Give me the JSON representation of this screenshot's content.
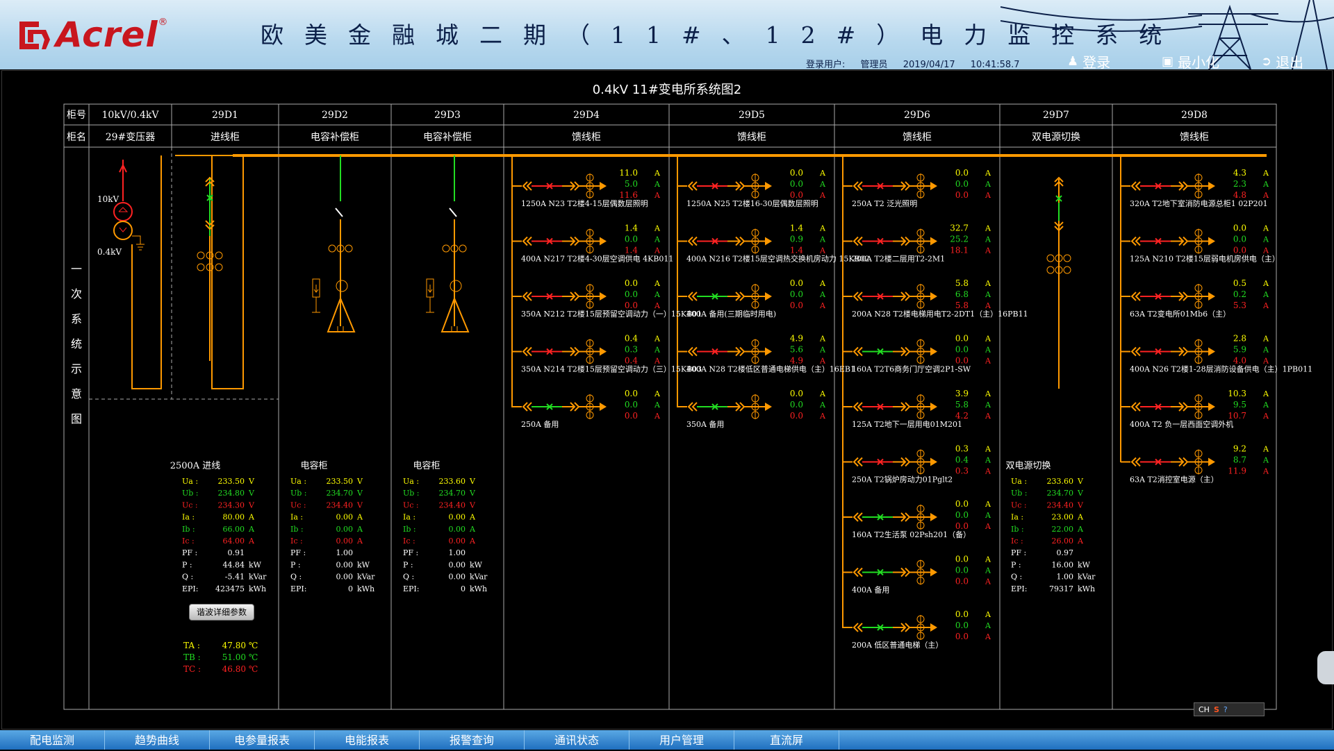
{
  "header": {
    "logo": "Acrel",
    "logo_reg": "®",
    "title": "欧美金融城二期（11#、12#）电力监控系统",
    "login_label": "登录用户:",
    "login_user": "管理员",
    "date": "2019/04/17",
    "time": "10:41:58.7",
    "btn_login": "登录",
    "btn_minimize": "最小化",
    "btn_exit": "退出"
  },
  "diagram": {
    "title": "0.4kV 11#变电所系统图2",
    "row1_label": "柜号",
    "row2_label": "柜名",
    "side_label": "一次系统示意图",
    "transformer_hv": "10kV",
    "transformer_lv": "0.4kV",
    "cabinets": [
      {
        "no": "10kV/0.4kV",
        "name": "29#变压器"
      },
      {
        "no": "29D1",
        "name": "进线柜"
      },
      {
        "no": "29D2",
        "name": "电容补偿柜"
      },
      {
        "no": "29D3",
        "name": "电容补偿柜"
      },
      {
        "no": "29D4",
        "name": "馈线柜"
      },
      {
        "no": "29D5",
        "name": "馈线柜"
      },
      {
        "no": "29D6",
        "name": "馈线柜"
      },
      {
        "no": "29D7",
        "name": "双电源切换"
      },
      {
        "no": "29D8",
        "name": "馈线柜"
      }
    ]
  },
  "feeders": {
    "d4": [
      {
        "label": "1250A N23 T2楼4-15层偶数层照明",
        "ia": "11.0",
        "ib": "5.0",
        "ic": "11.6",
        "on": false
      },
      {
        "label": "400A N217 T2楼4-30层空调供电 4KB011",
        "ia": "1.4",
        "ib": "0.0",
        "ic": "1.4",
        "on": false
      },
      {
        "label": "350A N212 T2楼15层预留空调动力（一）15KB01",
        "ia": "0.0",
        "ib": "0.0",
        "ic": "0.0",
        "on": false
      },
      {
        "label": "350A N214 T2楼15层预留空调动力（三）15KB03",
        "ia": "0.4",
        "ib": "0.3",
        "ic": "0.4",
        "on": false
      },
      {
        "label": "250A 备用",
        "ia": "0.0",
        "ib": "0.0",
        "ic": "0.0",
        "on": true
      }
    ],
    "d5": [
      {
        "label": "1250A N25 T2楼16-30层偶数层照明",
        "ia": "0.0",
        "ib": "0.0",
        "ic": "0.0",
        "on": false
      },
      {
        "label": "400A N216 T2楼15层空调热交换机房动力 15KB02",
        "ia": "1.4",
        "ib": "0.9",
        "ic": "1.4",
        "on": false
      },
      {
        "label": "400A 备用(三期临时用电)",
        "ia": "0.0",
        "ib": "0.0",
        "ic": "0.0",
        "on": true
      },
      {
        "label": "400A N28 T2楼低区普通电梯供电（主）16EB1",
        "ia": "4.9",
        "ib": "5.6",
        "ic": "4.9",
        "on": false
      },
      {
        "label": "350A 备用",
        "ia": "0.0",
        "ib": "0.0",
        "ic": "0.0",
        "on": true
      }
    ],
    "d6": [
      {
        "label": "250A T2 泛光照明",
        "ia": "0.0",
        "ib": "0.0",
        "ic": "0.0",
        "on": false
      },
      {
        "label": "200A T2楼二层用T2-2M1",
        "ia": "32.7",
        "ib": "25.2",
        "ic": "18.1",
        "on": false
      },
      {
        "label": "200A N28 T2楼电梯用电T2-2DT1（主）16PB11",
        "ia": "5.8",
        "ib": "6.8",
        "ic": "5.8",
        "on": false
      },
      {
        "label": "160A T2T6商务门厅空调2P1-SW",
        "ia": "0.0",
        "ib": "0.0",
        "ic": "0.0",
        "on": true
      },
      {
        "label": "125A T2地下一层用电01M201",
        "ia": "3.9",
        "ib": "5.8",
        "ic": "4.2",
        "on": false
      },
      {
        "label": "250A T2锅炉房动力01Pglt2",
        "ia": "0.3",
        "ib": "0.4",
        "ic": "0.3",
        "on": false
      },
      {
        "label": "160A T2生活泵 02Psh201（备）",
        "ia": "0.0",
        "ib": "0.0",
        "ic": "0.0",
        "on": true
      },
      {
        "label": "400A 备用",
        "ia": "0.0",
        "ib": "0.0",
        "ic": "0.0",
        "on": true
      },
      {
        "label": "200A 低区普通电梯（主）",
        "ia": "0.0",
        "ib": "0.0",
        "ic": "0.0",
        "on": true
      }
    ],
    "d8": [
      {
        "label": "320A T2地下室消防电源总柜1 02P201",
        "ia": "4.3",
        "ib": "2.3",
        "ic": "4.8",
        "on": false
      },
      {
        "label": "125A N210 T2楼15层弱电机房供电（主）",
        "ia": "0.0",
        "ib": "0.0",
        "ic": "0.0",
        "on": false
      },
      {
        "label": "63A T2变电所01Mb6（主）",
        "ia": "0.5",
        "ib": "0.2",
        "ic": "5.3",
        "on": false
      },
      {
        "label": "400A N26 T2楼1-28层消防设备供电（主）1PB011",
        "ia": "2.8",
        "ib": "5.9",
        "ic": "4.0",
        "on": false
      },
      {
        "label": "400A T2 负一层西面空调外机",
        "ia": "10.3",
        "ib": "9.5",
        "ic": "10.7",
        "on": false
      },
      {
        "label": "63A T2消控室电源（主）",
        "ia": "9.2",
        "ib": "8.7",
        "ic": "11.9",
        "on": false
      }
    ]
  },
  "unit_a": "A",
  "param_labels": {
    "ua": "Ua :",
    "ub": "Ub :",
    "uc": "Uc :",
    "ia": "Ia :",
    "ib": "Ib :",
    "ic": "Ic :",
    "pf": "PF :",
    "p": "P :",
    "q": "Q :",
    "epi": "EPI:"
  },
  "units": {
    "v": "V",
    "a": "A",
    "kw": "kW",
    "kvar": "kVar",
    "kwh": "kWh",
    "c": "℃"
  },
  "panels": [
    {
      "title": "2500A 进线",
      "ua": "233.50",
      "ub": "234.80",
      "uc": "234.30",
      "ia": "80.00",
      "ib": "66.00",
      "ic": "64.00",
      "pf": "0.91",
      "p": "44.84",
      "q": "-5.41",
      "epi": "423475"
    },
    {
      "title": "电容柜",
      "ua": "233.50",
      "ub": "234.70",
      "uc": "234.40",
      "ia": "0.00",
      "ib": "0.00",
      "ic": "0.00",
      "pf": "1.00",
      "p": "0.00",
      "q": "0.00",
      "epi": "0"
    },
    {
      "title": "电容柜",
      "ua": "233.60",
      "ub": "234.70",
      "uc": "234.40",
      "ia": "0.00",
      "ib": "0.00",
      "ic": "0.00",
      "pf": "1.00",
      "p": "0.00",
      "q": "0.00",
      "epi": "0"
    },
    {
      "title": "双电源切换",
      "ua": "233.60",
      "ub": "234.70",
      "uc": "234.40",
      "ia": "23.00",
      "ib": "22.00",
      "ic": "26.00",
      "pf": "0.97",
      "p": "16.00",
      "q": "1.00",
      "epi": "79317"
    }
  ],
  "harmonic_button": "谐波详细参数",
  "temps": {
    "ta_label": "TA :",
    "tb_label": "TB :",
    "tc_label": "TC :",
    "ta": "47.80",
    "tb": "51.00",
    "tc": "46.80"
  },
  "ime": {
    "label": "CH"
  },
  "footer_tabs": [
    "配电监测",
    "趋势曲线",
    "电参量报表",
    "电能报表",
    "报警查询",
    "通讯状态",
    "用户管理",
    "直流屏"
  ],
  "colors": {
    "bus": "#ff9900",
    "on": "#22dd22",
    "off": "#ff2222",
    "phase_a": "#ffff00",
    "phase_b": "#22dd22",
    "phase_c": "#ff2222"
  }
}
